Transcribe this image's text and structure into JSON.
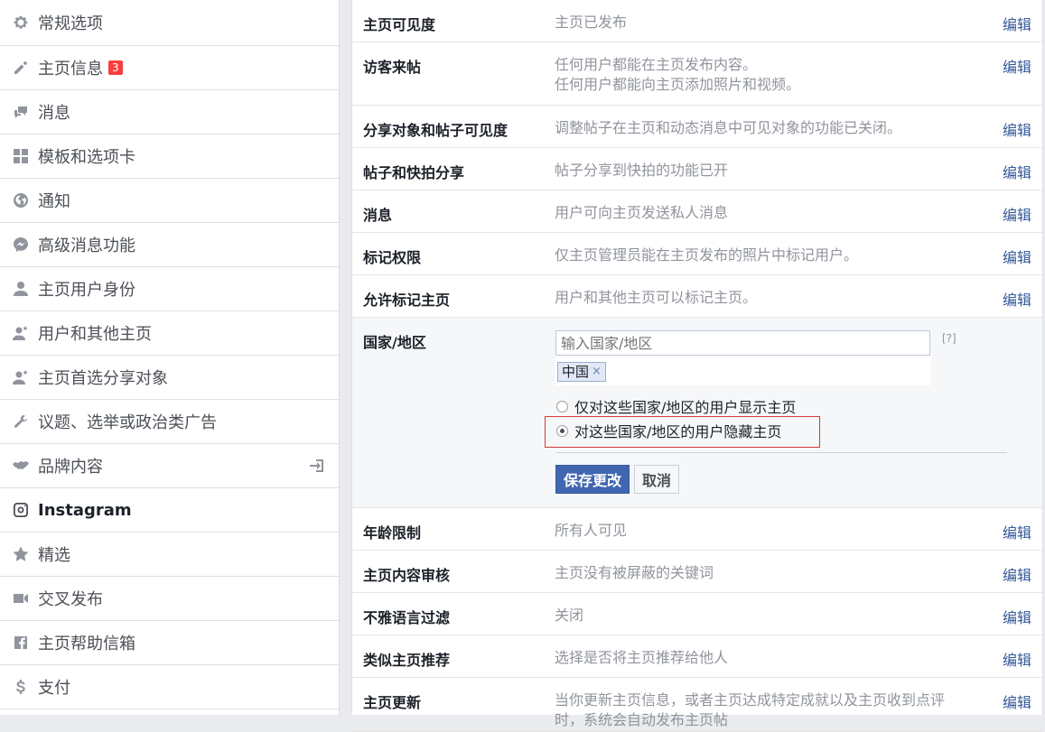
{
  "sidebar": {
    "items": [
      {
        "label": "常规选项",
        "icon": "gear-icon"
      },
      {
        "label": "主页信息",
        "icon": "pencil-icon",
        "badge": "3"
      },
      {
        "label": "消息",
        "icon": "chat-icon"
      },
      {
        "label": "模板和选项卡",
        "icon": "grid-icon"
      },
      {
        "label": "通知",
        "icon": "globe-icon"
      },
      {
        "label": "高级消息功能",
        "icon": "messenger-icon"
      },
      {
        "label": "主页用户身份",
        "icon": "person-icon"
      },
      {
        "label": "用户和其他主页",
        "icon": "person-star-icon"
      },
      {
        "label": "主页首选分享对象",
        "icon": "person-star-icon"
      },
      {
        "label": "议题、选举或政治类广告",
        "icon": "wrench-icon"
      },
      {
        "label": "品牌内容",
        "icon": "handshake-icon"
      },
      {
        "label": "Instagram",
        "icon": "instagram-icon"
      },
      {
        "label": "精选",
        "icon": "star-icon"
      },
      {
        "label": "交叉发布",
        "icon": "video-icon"
      },
      {
        "label": "主页帮助信箱",
        "icon": "facebook-icon"
      },
      {
        "label": "支付",
        "icon": "dollar-icon"
      }
    ]
  },
  "settings": {
    "edit_label": "编辑",
    "rows_top": [
      {
        "label": "主页可见度",
        "desc": "主页已发布"
      },
      {
        "label": "访客来帖",
        "desc": "任何用户都能在主页发布内容。\n任何用户都能向主页添加照片和视频。"
      },
      {
        "label": "分享对象和帖子可见度",
        "desc": "调整帖子在主页和动态消息中可见对象的功能已关闭。"
      },
      {
        "label": "帖子和快拍分享",
        "desc": "帖子分享到快拍的功能已开"
      },
      {
        "label": "消息",
        "desc": "用户可向主页发送私人消息"
      },
      {
        "label": "标记权限",
        "desc": "仅主页管理员能在主页发布的照片中标记用户。"
      },
      {
        "label": "允许标记主页",
        "desc": "用户和其他主页可以标记主页。"
      }
    ],
    "country": {
      "label": "国家/地区",
      "input_placeholder": "输入国家/地区",
      "help": "[?]",
      "token": "中国",
      "token_remove": "×",
      "option_show": "仅对这些国家/地区的用户显示主页",
      "option_hide": "对这些国家/地区的用户隐藏主页",
      "selected": "hide",
      "save_label": "保存更改",
      "cancel_label": "取消"
    },
    "rows_bottom": [
      {
        "label": "年龄限制",
        "desc": "所有人可见"
      },
      {
        "label": "主页内容审核",
        "desc": "主页没有被屏蔽的关键词"
      },
      {
        "label": "不雅语言过滤",
        "desc": "关闭"
      },
      {
        "label": "类似主页推荐",
        "desc": "选择是否将主页推荐给他人"
      },
      {
        "label": "主页更新",
        "desc": "当你更新主页信息，或者主页达成特定成就以及主页收到点评时，系统会自动发布主页帖"
      }
    ]
  },
  "colors": {
    "link": "#365899",
    "primary_button": "#4267b2",
    "highlight_border": "#d83a3a",
    "badge": "#fa3e3e"
  }
}
